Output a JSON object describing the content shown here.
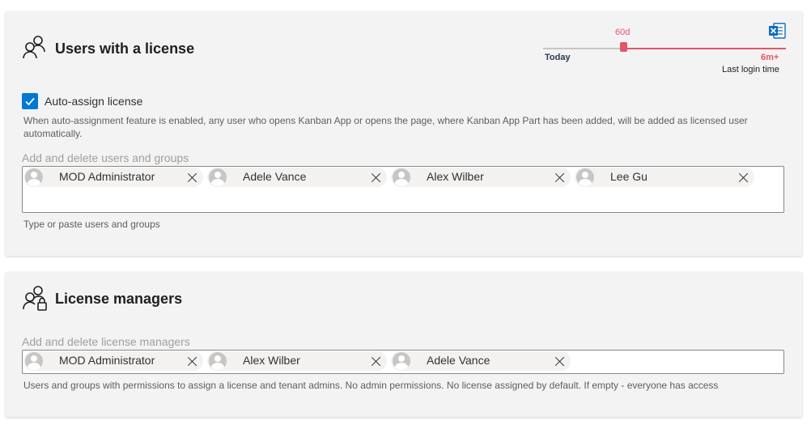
{
  "users_section": {
    "title": "Users with a license",
    "icon": "users-icon",
    "export_icon": "excel-export-icon",
    "login_slider": {
      "value_label": "60d",
      "min_label": "Today",
      "max_label": "6m+",
      "caption": "Last login time"
    },
    "auto_assign": {
      "checked": true,
      "label": "Auto-assign license",
      "description": "When auto-assignment feature is enabled, any user who opens Kanban App or opens the page, where Kanban App Part has been added, will be added as licensed user automatically."
    },
    "picker": {
      "label": "Add and delete users and groups",
      "chips": [
        {
          "name": "MOD Administrator"
        },
        {
          "name": "Adele Vance"
        },
        {
          "name": "Alex Wilber"
        },
        {
          "name": "Lee Gu"
        }
      ],
      "helper": "Type or paste users and groups"
    }
  },
  "managers_section": {
    "title": "License managers",
    "icon": "user-lock-icon",
    "picker": {
      "label": "Add and delete license managers",
      "chips": [
        {
          "name": "MOD Administrator"
        },
        {
          "name": "Alex Wilber"
        },
        {
          "name": "Adele Vance"
        }
      ],
      "helper": "Users and groups with permissions to assign a license and tenant admins. No admin permissions. No license assigned by default. If empty - everyone has access"
    }
  },
  "colors": {
    "accent": "#0078d4",
    "slider": "#e3566a",
    "card_background": "#f3f3f3"
  }
}
